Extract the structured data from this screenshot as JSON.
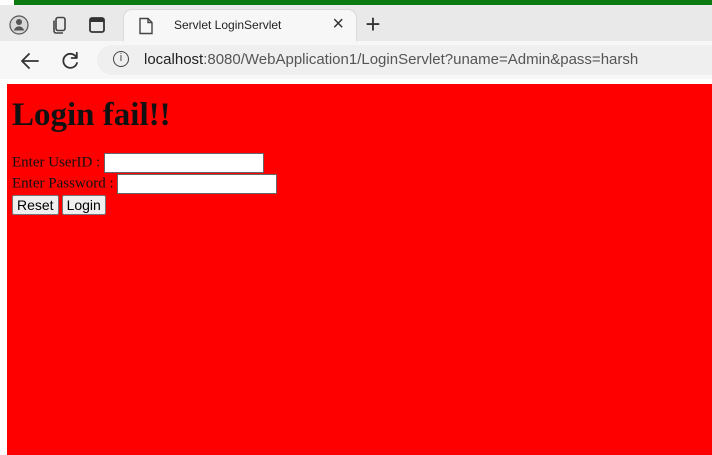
{
  "browser": {
    "tab_title": "Servlet LoginServlet",
    "close_tab": "×",
    "new_tab": "+",
    "url_host": "localhost",
    "url_rest": ":8080/WebApplication1/LoginServlet?uname=Admin&pass=harsh"
  },
  "page": {
    "title": "Login fail!!",
    "user_label": "Enter UserID :",
    "pass_label": "Enter Password :",
    "reset_label": "Reset",
    "login_label": "Login",
    "background": "#ff0000"
  }
}
